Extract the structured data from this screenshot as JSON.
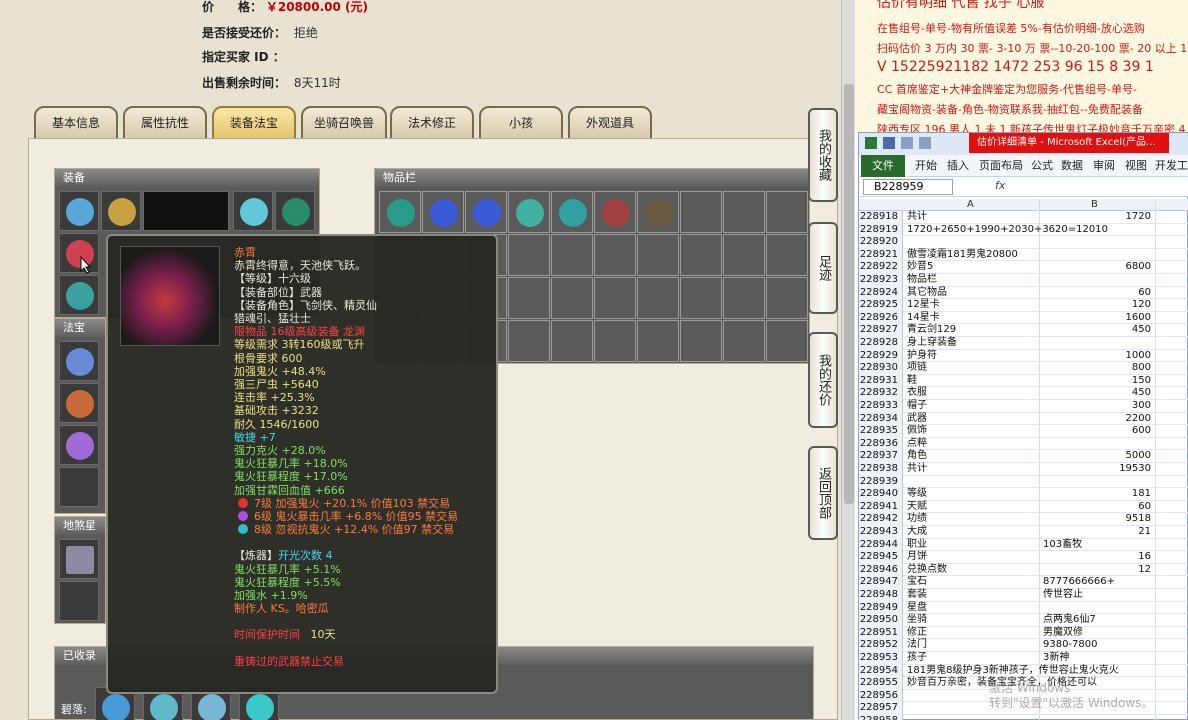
{
  "listing": {
    "price_label": "价　　格：",
    "price_value": "￥20800.00 (元)",
    "bargain_label": "是否接受还价：",
    "bargain_value": "拒绝",
    "buyer_label": "指定买家 ID ：",
    "buyer_value": "",
    "time_label": "出售剩余时间：",
    "time_value": "8天11时"
  },
  "tabs": [
    "基本信息",
    "属性抗性",
    "装备法宝",
    "坐骑召唤兽",
    "法术修正",
    "小孩",
    "外观道具"
  ],
  "active_tab": "装备法宝",
  "panels": {
    "equipment": "装备",
    "inventory": "物品栏",
    "fabao": "法宝",
    "lingshi": "地煞星",
    "collected": "已收录",
    "collected_row_label": "碧落:"
  },
  "side_buttons": [
    "我的收藏",
    "足迹",
    "我的还价",
    "返回顶部"
  ],
  "tooltip": {
    "name": "赤霄",
    "lines": [
      {
        "t": "赤霄终得意，天池侠飞跃。",
        "c": "w"
      },
      {
        "t": "【等级】十六级",
        "c": "w"
      },
      {
        "t": "【装备部位】武器",
        "c": "w"
      },
      {
        "t": "【装备角色】飞剑侠、精灵仙",
        "c": "w"
      },
      {
        "t": "猎魂引、猛壮士",
        "c": "w"
      },
      {
        "t": "限物品 16级高级装备 龙渊",
        "c": "r"
      },
      {
        "t": "等级需求 3转160级或飞升",
        "c": "y"
      },
      {
        "t": "根骨要求 600",
        "c": "y"
      },
      {
        "t": "加强鬼火 +48.4%",
        "c": "y"
      },
      {
        "t": "强三尸虫 +5640",
        "c": "y"
      },
      {
        "t": "连击率 +25.3%",
        "c": "y"
      },
      {
        "t": "基础攻击 +3232",
        "c": "y"
      },
      {
        "t": "耐久 1546/1600",
        "c": "y"
      },
      {
        "t": "敏捷 +7",
        "c": "c"
      },
      {
        "t": "强力克火 +28.0%",
        "c": "g"
      },
      {
        "t": "鬼火狂暴几率 +18.0%",
        "c": "g"
      },
      {
        "t": "鬼火狂暴程度 +17.0%",
        "c": "g"
      },
      {
        "t": "加强甘霖回血值 +666",
        "c": "g"
      }
    ],
    "gems": [
      {
        "t": "7级 加强鬼火 +20.1% 价值103 禁交易",
        "color": "#e03030"
      },
      {
        "t": "6级 鬼火暴击几率 +6.8% 价值95 禁交易",
        "color": "#b050e0"
      },
      {
        "t": "8级 忽视抗鬼火 +12.4% 价值97 禁交易",
        "color": "#30c0c0"
      }
    ],
    "refine_label": "【炼器】",
    "refine_count": "开光次数 4",
    "refine_lines": [
      "鬼火狂暴几率 +5.1%",
      "鬼火狂暴程度 +5.5%",
      "加强水 +1.9%"
    ],
    "maker": "制作人 KS。哈密瓜",
    "protect_label": "时间保护时间",
    "protect_value": "10天",
    "note": "重铸过的武器禁止交易"
  },
  "notice": {
    "line0": "估价有明细 代售 找子 心服",
    "line1": "在售组号-单号-物有所值误差 5%-有估价明细-放心选购",
    "line2": "扫码估价 3 万内 30 票- 3-10 万 票--10-20-100 票- 20 以上 150",
    "line3": "V 15225921182  1472 253 96  15 8 39 1",
    "line4": "CC 首席鉴定+大神金牌鉴定为您服务-代售组号-单号-",
    "line5": "藏宝阁物资-装备-角色-物资联系我-抽红包--免费配装备",
    "line6": "陕西专区 196 男人 1 未 1 新孩子传世鬼灯子极妙音千万亲密 4"
  },
  "excel": {
    "title": "估价详细清单 - Microsoft Excel(产品...",
    "ribbon": [
      "文件",
      "开始",
      "插入",
      "页面布局",
      "公式",
      "数据",
      "审阅",
      "视图",
      "开发工"
    ],
    "namebox": "B228959",
    "fx": "fx",
    "col_a": "A",
    "col_b": "B",
    "rows": [
      {
        "n": "228918",
        "a": "共计",
        "b": "1720",
        "num": true
      },
      {
        "n": "228919",
        "a": "1720+2650+1990+2030+3620=12010",
        "b": "",
        "num": false
      },
      {
        "n": "228920",
        "a": "",
        "b": "",
        "num": false
      },
      {
        "n": "228921",
        "a": "傲雪凌霜181男鬼20800",
        "b": "",
        "num": false
      },
      {
        "n": "228922",
        "a": "妙音5",
        "b": "6800",
        "num": true
      },
      {
        "n": "228923",
        "a": "物品栏",
        "b": "",
        "num": false
      },
      {
        "n": "228924",
        "a": "其它物品",
        "b": "60",
        "num": true
      },
      {
        "n": "228925",
        "a": "12星卡",
        "b": "120",
        "num": true
      },
      {
        "n": "228926",
        "a": "14星卡",
        "b": "1600",
        "num": true
      },
      {
        "n": "228927",
        "a": "青云剑129",
        "b": "450",
        "num": true
      },
      {
        "n": "228928",
        "a": "身上穿装备",
        "b": "",
        "num": false
      },
      {
        "n": "228929",
        "a": "护身符",
        "b": "1000",
        "num": true
      },
      {
        "n": "228930",
        "a": "项链",
        "b": "800",
        "num": true
      },
      {
        "n": "228931",
        "a": "鞋",
        "b": "150",
        "num": true
      },
      {
        "n": "228932",
        "a": "衣服",
        "b": "450",
        "num": true
      },
      {
        "n": "228933",
        "a": "帽子",
        "b": "300",
        "num": true
      },
      {
        "n": "228934",
        "a": "武器",
        "b": "2200",
        "num": true
      },
      {
        "n": "228935",
        "a": "佩饰",
        "b": "600",
        "num": true
      },
      {
        "n": "228936",
        "a": "点粹",
        "b": "",
        "num": false
      },
      {
        "n": "228937",
        "a": "角色",
        "b": "5000",
        "num": true
      },
      {
        "n": "228938",
        "a": "共计",
        "b": "19530",
        "num": true
      },
      {
        "n": "228939",
        "a": "",
        "b": "",
        "num": false
      },
      {
        "n": "228940",
        "a": "等级",
        "b": "181",
        "num": true
      },
      {
        "n": "228941",
        "a": "天赋",
        "b": "60",
        "num": true
      },
      {
        "n": "228942",
        "a": "功绩",
        "b": "9518",
        "num": true
      },
      {
        "n": "228943",
        "a": "大成",
        "b": "21",
        "num": true
      },
      {
        "n": "228944",
        "a": "职业",
        "b": "103畜牧",
        "num": false
      },
      {
        "n": "228945",
        "a": "月饼",
        "b": "16",
        "num": true
      },
      {
        "n": "228946",
        "a": "兑换点数",
        "b": "12",
        "num": true
      },
      {
        "n": "228947",
        "a": "宝石",
        "b": "8777666666+",
        "num": false
      },
      {
        "n": "228948",
        "a": "套装",
        "b": "传世容止",
        "num": false
      },
      {
        "n": "228949",
        "a": "星盘",
        "b": "",
        "num": false
      },
      {
        "n": "228950",
        "a": "坐骑",
        "b": "点两鬼6仙7",
        "num": false
      },
      {
        "n": "228951",
        "a": "修正",
        "b": "男魔双修",
        "num": false
      },
      {
        "n": "228952",
        "a": "法门",
        "b": "9380-7800",
        "num": false
      },
      {
        "n": "228953",
        "a": "孩子",
        "b": "3新神",
        "num": false
      },
      {
        "n": "228954",
        "a": "181男鬼8级护身3新神孩子，传世容止鬼火克火",
        "b": "",
        "num": false
      },
      {
        "n": "228955",
        "a": "妙音百万亲密，装备宝宝齐全，价格还可以",
        "b": "",
        "num": false
      },
      {
        "n": "228956",
        "a": "",
        "b": "",
        "num": false
      },
      {
        "n": "228957",
        "a": "",
        "b": "",
        "num": false
      },
      {
        "n": "228958",
        "a": "",
        "b": "",
        "num": false
      }
    ],
    "watermark1": "激活 Windows",
    "watermark2": "转到\"设置\"以激活 Windows。"
  }
}
